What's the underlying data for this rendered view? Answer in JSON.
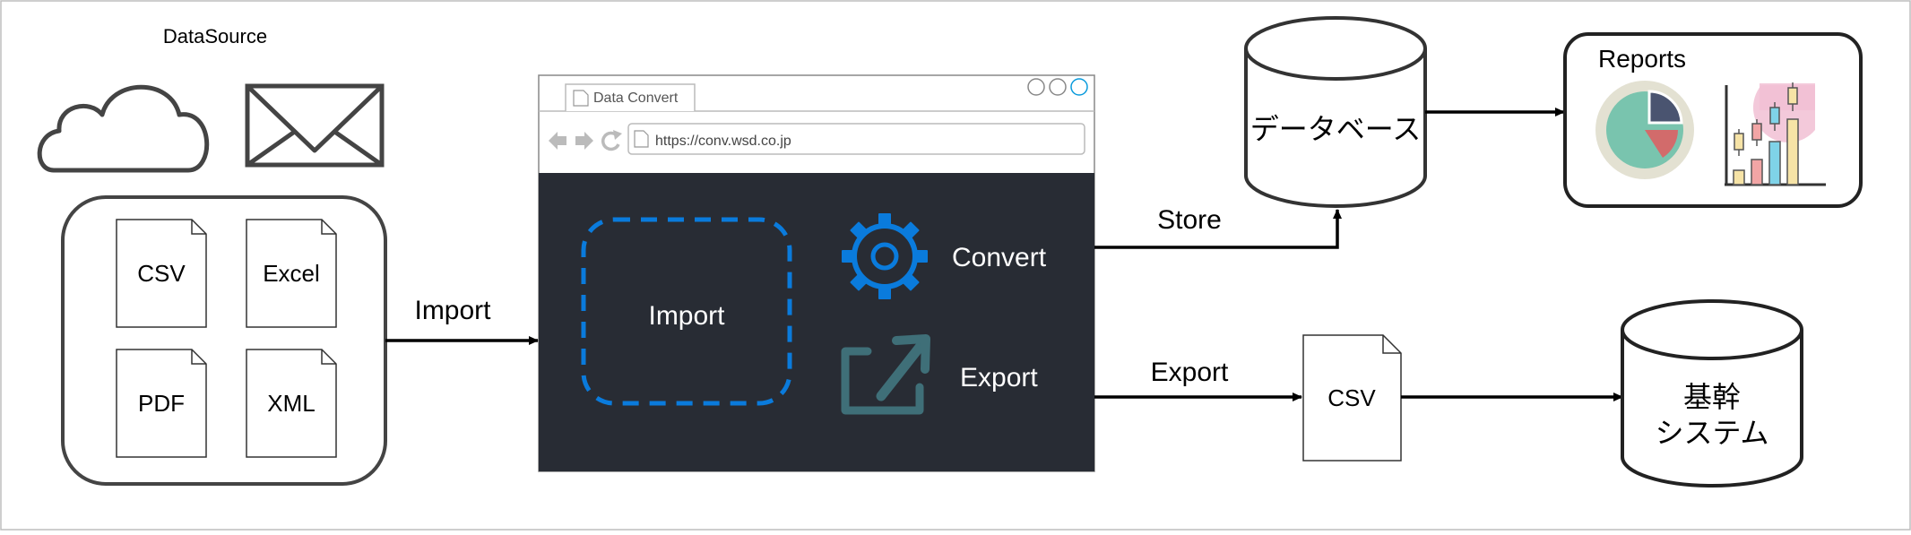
{
  "colors": {
    "stroke": "#444444",
    "line": "#000000",
    "browser_body": "#282c34",
    "accent_blue": "#0a7bdc",
    "export_icon": "#3f6f78",
    "pie_bg": "#e3e1d2",
    "pie_main": "#79c4ae",
    "pie_dark": "#4a5470",
    "pie_red": "#d26b6b"
  },
  "datasource": {
    "title": "DataSource",
    "icons": [
      "cloud-icon",
      "envelope-icon"
    ],
    "files": [
      "CSV",
      "Excel",
      "PDF",
      "XML"
    ]
  },
  "arrows": {
    "import": "Import",
    "store": "Store",
    "export": "Export"
  },
  "browser": {
    "tab_label": "Data Convert",
    "url": "https://conv.wsd.co.jp",
    "import_label": "Import",
    "convert_label": "Convert",
    "export_label": "Export"
  },
  "database": {
    "label": "データベース"
  },
  "reports": {
    "title": "Reports"
  },
  "csv_output": {
    "label": "CSV"
  },
  "core_system": {
    "line1": "基幹",
    "line2": "システム"
  }
}
